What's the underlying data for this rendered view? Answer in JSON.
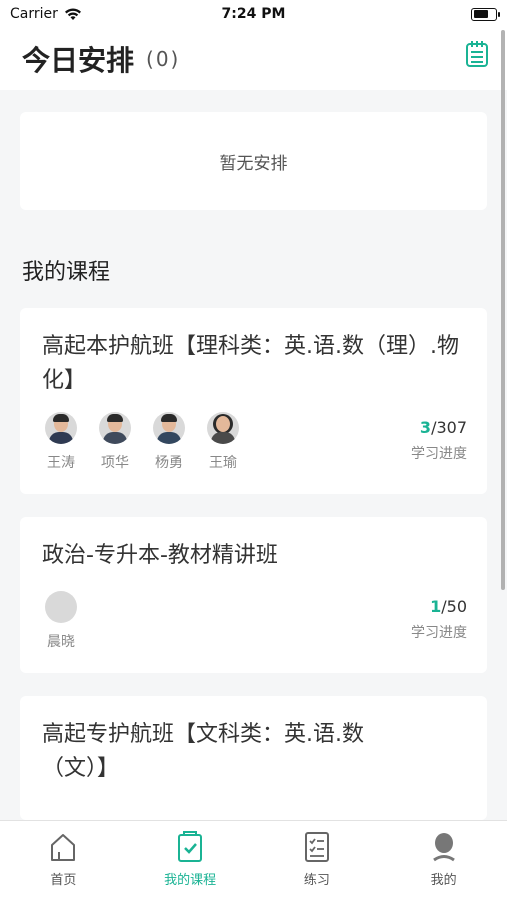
{
  "status_bar": {
    "carrier": "Carrier",
    "time": "7:24 PM"
  },
  "header": {
    "title": "今日安排",
    "count": "(0)"
  },
  "schedule": {
    "empty_text": "暂无安排"
  },
  "section": {
    "title": "我的课程"
  },
  "courses": [
    {
      "title": "高起本护航班【理科类：英.语.数（理）.物化】",
      "teachers": [
        "王涛",
        "项华",
        "杨勇",
        "王瑜"
      ],
      "progress_done": "3",
      "progress_total": "/307",
      "progress_label": "学习进度"
    },
    {
      "title": "政治-专升本-教材精讲班",
      "teachers": [
        "晨晓"
      ],
      "progress_done": "1",
      "progress_total": "/50",
      "progress_label": "学习进度"
    },
    {
      "title": "高起专护航班【文科类：英.语.数（文）】",
      "teachers": [],
      "progress_done": "",
      "progress_total": "",
      "progress_label": ""
    }
  ],
  "tabs": [
    {
      "label": "首页",
      "icon": "home-icon",
      "active": false
    },
    {
      "label": "我的课程",
      "icon": "course-icon",
      "active": true
    },
    {
      "label": "练习",
      "icon": "practice-icon",
      "active": false
    },
    {
      "label": "我的",
      "icon": "profile-icon",
      "active": false
    }
  ],
  "colors": {
    "accent": "#1ab394",
    "background": "#f5f6f7"
  }
}
